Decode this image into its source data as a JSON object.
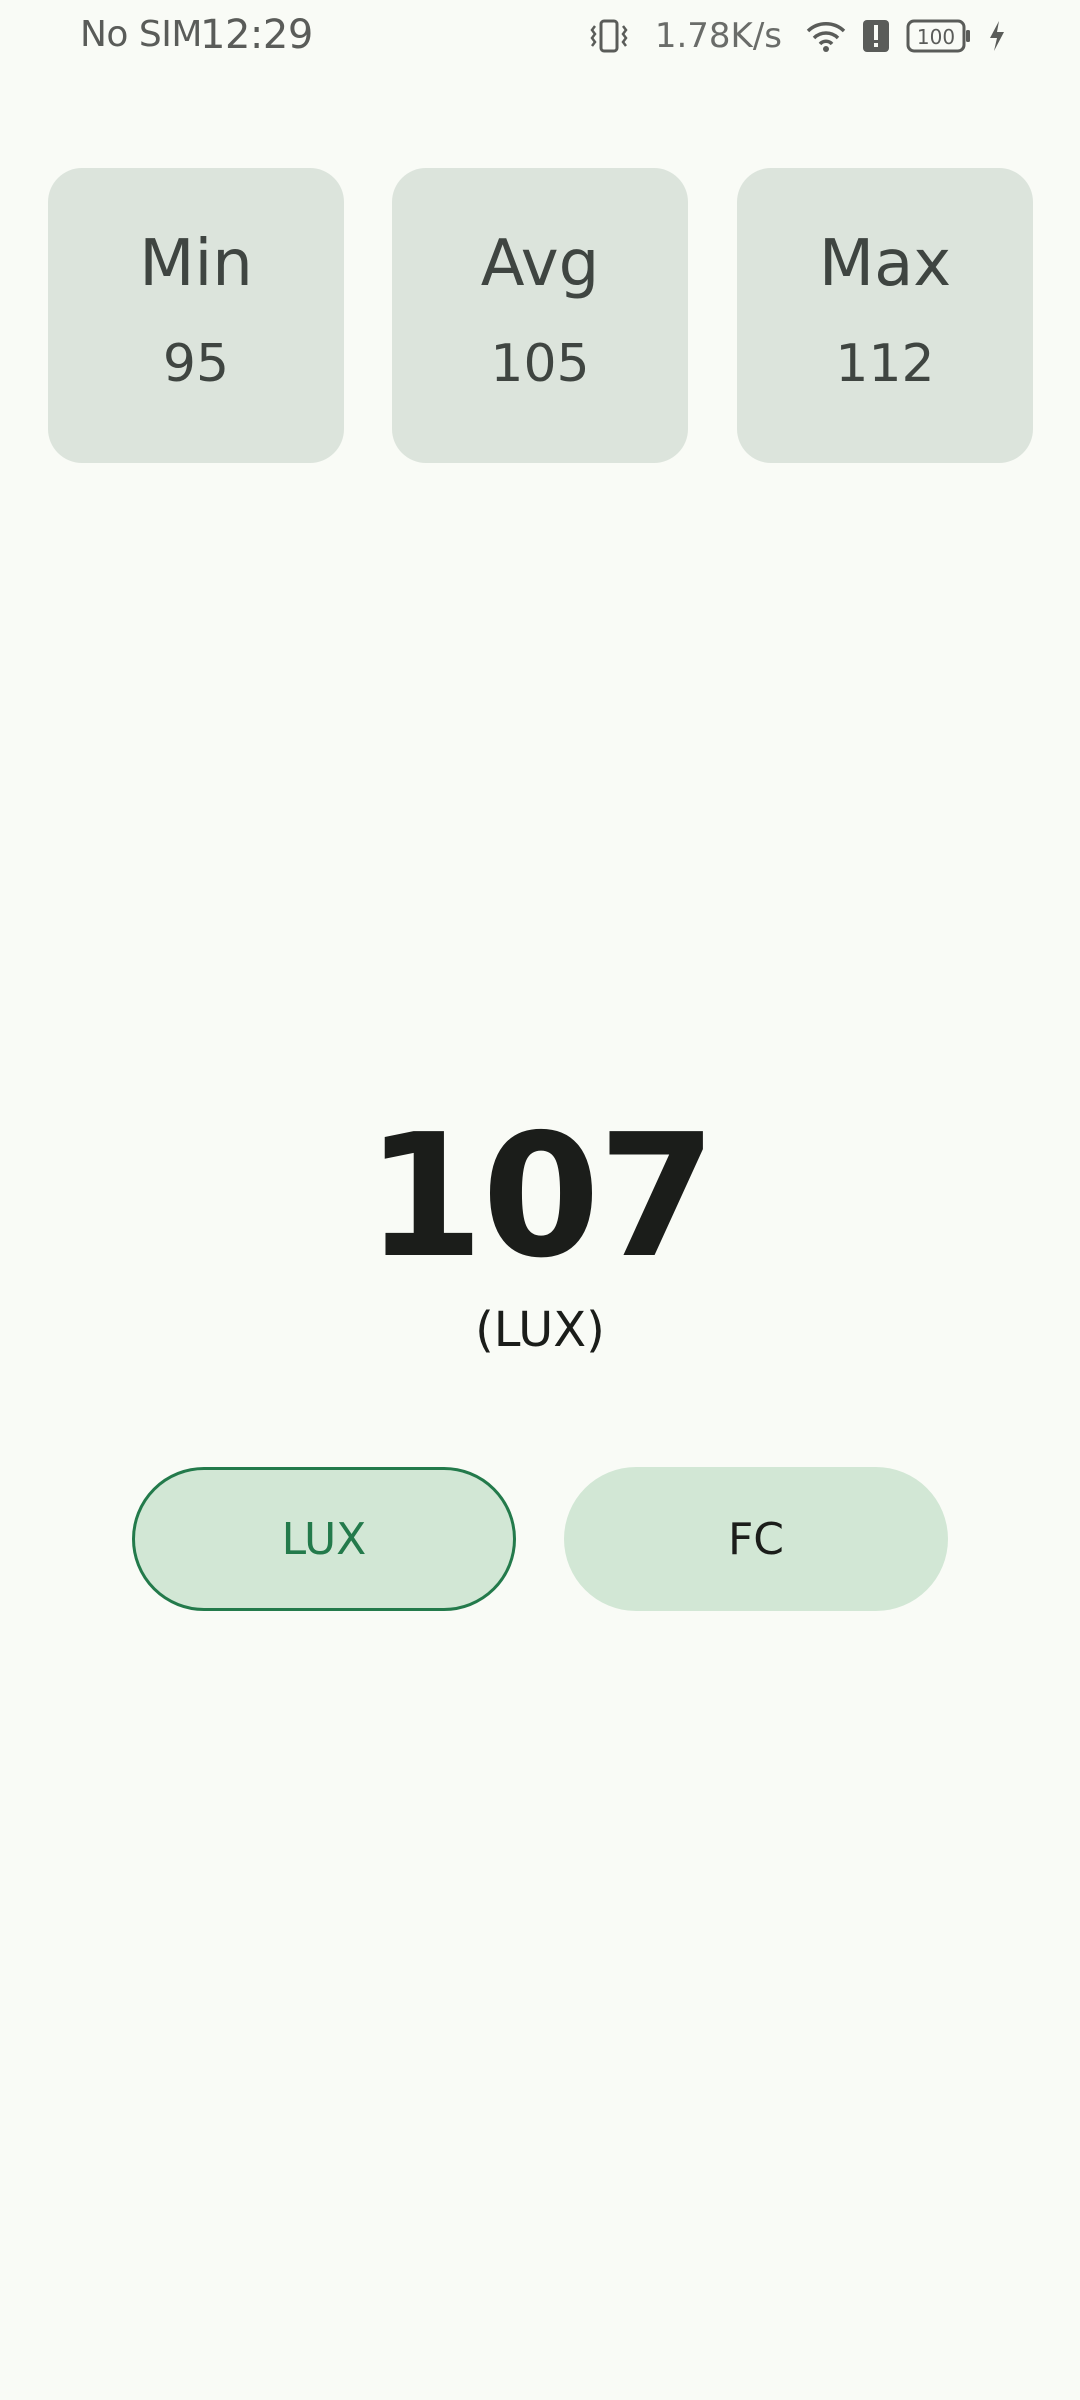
{
  "status_bar": {
    "carrier": "No SIM",
    "time": "12:29",
    "network_speed": "1.78K/s",
    "battery": "100",
    "icons": [
      "vibrate-icon",
      "wifi-icon",
      "alert-icon",
      "battery-icon",
      "charging-icon"
    ]
  },
  "stats": {
    "min": {
      "label": "Min",
      "value": "95"
    },
    "avg": {
      "label": "Avg",
      "value": "105"
    },
    "max": {
      "label": "Max",
      "value": "112"
    }
  },
  "reading": {
    "value": "107",
    "unit": "(LUX)"
  },
  "unit_buttons": {
    "lux": "LUX",
    "fc": "FC",
    "selected": "LUX"
  },
  "colors": {
    "background": "#f9fbf6",
    "card": "#dce4dc",
    "button": "#d2e7d5",
    "accent": "#237a4b"
  }
}
